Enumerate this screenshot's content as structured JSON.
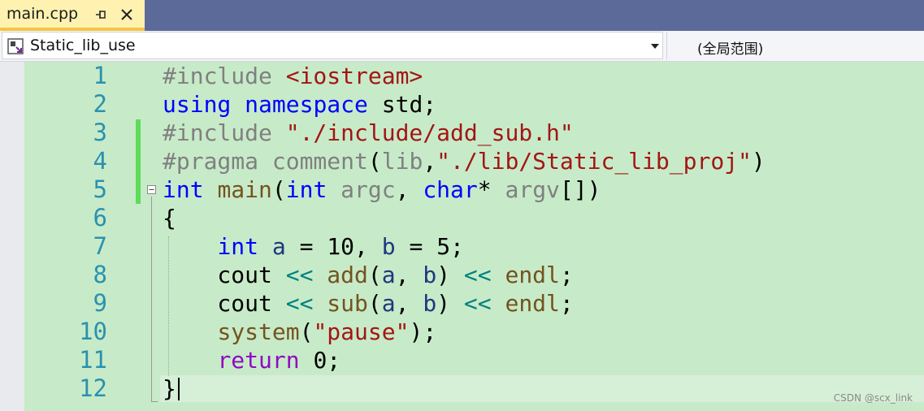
{
  "tab": {
    "title": "main.cpp",
    "pin_icon": "pin-icon",
    "close_icon": "close-icon"
  },
  "navbar": {
    "project": "Static_lib_use",
    "project_icon": "project-icon",
    "dropdown_icon": "chevron-down-icon",
    "scope": "(全局范围)"
  },
  "editor": {
    "line_numbers": [
      "1",
      "2",
      "3",
      "4",
      "5",
      "6",
      "7",
      "8",
      "9",
      "10",
      "11",
      "12"
    ],
    "lines": [
      {
        "tokens": [
          {
            "t": "#include ",
            "c": "pp"
          },
          {
            "t": "<iostream>",
            "c": "st"
          }
        ]
      },
      {
        "tokens": [
          {
            "t": "using ",
            "c": "kw"
          },
          {
            "t": "namespace ",
            "c": "kw"
          },
          {
            "t": "std;",
            "c": ""
          }
        ]
      },
      {
        "tokens": [
          {
            "t": "#include ",
            "c": "pp"
          },
          {
            "t": "\"./include/add_sub.h\"",
            "c": "st"
          }
        ]
      },
      {
        "tokens": [
          {
            "t": "#pragma ",
            "c": "pp"
          },
          {
            "t": "comment",
            "c": "pp"
          },
          {
            "t": "(",
            "c": ""
          },
          {
            "t": "lib",
            "c": "pp"
          },
          {
            "t": ",",
            "c": ""
          },
          {
            "t": "\"./lib/Static_lib_proj\"",
            "c": "st"
          },
          {
            "t": ")",
            "c": ""
          }
        ]
      },
      {
        "tokens": [
          {
            "t": "int ",
            "c": "kw"
          },
          {
            "t": "main",
            "c": "fn"
          },
          {
            "t": "(",
            "c": ""
          },
          {
            "t": "int ",
            "c": "kw"
          },
          {
            "t": "argc",
            "c": "pr"
          },
          {
            "t": ", ",
            "c": ""
          },
          {
            "t": "char",
            "c": "kw"
          },
          {
            "t": "* ",
            "c": ""
          },
          {
            "t": "argv",
            "c": "pr"
          },
          {
            "t": "[])",
            "c": ""
          }
        ]
      },
      {
        "tokens": [
          {
            "t": "{",
            "c": ""
          }
        ]
      },
      {
        "tokens": [
          {
            "t": "    ",
            "c": ""
          },
          {
            "t": "int ",
            "c": "kw"
          },
          {
            "t": "a",
            "c": "ty"
          },
          {
            "t": " = ",
            "c": ""
          },
          {
            "t": "10",
            "c": "num"
          },
          {
            "t": ", ",
            "c": ""
          },
          {
            "t": "b",
            "c": "ty"
          },
          {
            "t": " = ",
            "c": ""
          },
          {
            "t": "5",
            "c": "num"
          },
          {
            "t": ";",
            "c": ""
          }
        ]
      },
      {
        "tokens": [
          {
            "t": "    cout ",
            "c": ""
          },
          {
            "t": "<< ",
            "c": "op"
          },
          {
            "t": "add",
            "c": "fn"
          },
          {
            "t": "(",
            "c": ""
          },
          {
            "t": "a",
            "c": "ty"
          },
          {
            "t": ", ",
            "c": ""
          },
          {
            "t": "b",
            "c": "ty"
          },
          {
            "t": ") ",
            "c": ""
          },
          {
            "t": "<< ",
            "c": "op"
          },
          {
            "t": "endl",
            "c": "fn"
          },
          {
            "t": ";",
            "c": ""
          }
        ]
      },
      {
        "tokens": [
          {
            "t": "    cout ",
            "c": ""
          },
          {
            "t": "<< ",
            "c": "op"
          },
          {
            "t": "sub",
            "c": "fn"
          },
          {
            "t": "(",
            "c": ""
          },
          {
            "t": "a",
            "c": "ty"
          },
          {
            "t": ", ",
            "c": ""
          },
          {
            "t": "b",
            "c": "ty"
          },
          {
            "t": ") ",
            "c": ""
          },
          {
            "t": "<< ",
            "c": "op"
          },
          {
            "t": "endl",
            "c": "fn"
          },
          {
            "t": ";",
            "c": ""
          }
        ]
      },
      {
        "tokens": [
          {
            "t": "    ",
            "c": ""
          },
          {
            "t": "system",
            "c": "fn"
          },
          {
            "t": "(",
            "c": ""
          },
          {
            "t": "\"pause\"",
            "c": "st"
          },
          {
            "t": ");",
            "c": ""
          }
        ]
      },
      {
        "tokens": [
          {
            "t": "    ",
            "c": ""
          },
          {
            "t": "return ",
            "c": "ctl"
          },
          {
            "t": "0;",
            "c": ""
          }
        ]
      },
      {
        "tokens": [
          {
            "t": "}",
            "c": ""
          }
        ]
      }
    ]
  },
  "watermark": "CSDN @scx_link"
}
